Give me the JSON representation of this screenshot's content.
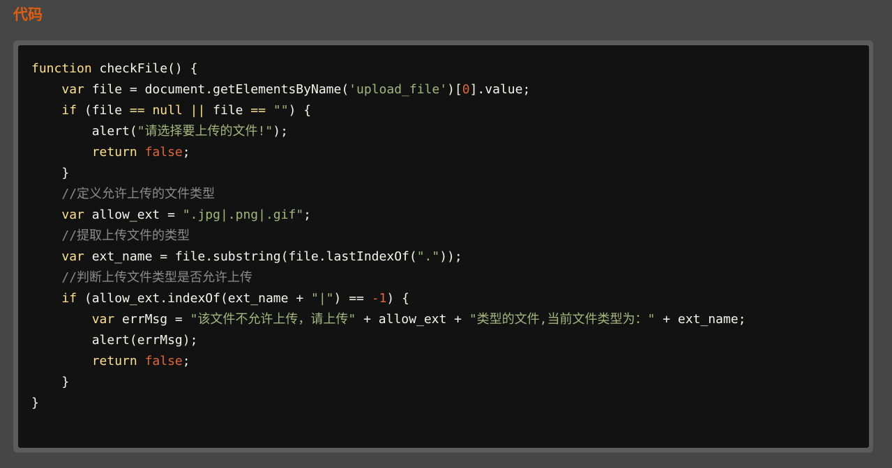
{
  "section": {
    "title": "代码"
  },
  "code": {
    "language": "javascript",
    "lines": [
      [
        {
          "t": "kw",
          "v": "function"
        },
        {
          "t": "pl",
          "v": " checkFile() {"
        }
      ],
      [
        {
          "t": "pl",
          "v": "    "
        },
        {
          "t": "kw",
          "v": "var"
        },
        {
          "t": "pl",
          "v": " file = document.getElementsByName("
        },
        {
          "t": "str",
          "v": "'upload_file'"
        },
        {
          "t": "pl",
          "v": ")["
        },
        {
          "t": "num",
          "v": "0"
        },
        {
          "t": "pl",
          "v": "].value;"
        }
      ],
      [
        {
          "t": "pl",
          "v": "    "
        },
        {
          "t": "kw",
          "v": "if"
        },
        {
          "t": "pl",
          "v": " (file "
        },
        {
          "t": "kw",
          "v": "=="
        },
        {
          "t": "pl",
          "v": " "
        },
        {
          "t": "kw",
          "v": "null"
        },
        {
          "t": "pl",
          "v": " "
        },
        {
          "t": "kw",
          "v": "||"
        },
        {
          "t": "pl",
          "v": " file "
        },
        {
          "t": "kw",
          "v": "=="
        },
        {
          "t": "pl",
          "v": " "
        },
        {
          "t": "str",
          "v": "\"\""
        },
        {
          "t": "pl",
          "v": ") {"
        }
      ],
      [
        {
          "t": "pl",
          "v": "        alert("
        },
        {
          "t": "str",
          "v": "\"请选择要上传的文件!\""
        },
        {
          "t": "pl",
          "v": ");"
        }
      ],
      [
        {
          "t": "pl",
          "v": "        "
        },
        {
          "t": "kw",
          "v": "return"
        },
        {
          "t": "pl",
          "v": " "
        },
        {
          "t": "bool",
          "v": "false"
        },
        {
          "t": "pl",
          "v": ";"
        }
      ],
      [
        {
          "t": "pl",
          "v": "    }"
        }
      ],
      [
        {
          "t": "pl",
          "v": "    "
        },
        {
          "t": "com",
          "v": "//定义允许上传的文件类型"
        }
      ],
      [
        {
          "t": "pl",
          "v": "    "
        },
        {
          "t": "kw",
          "v": "var"
        },
        {
          "t": "pl",
          "v": " allow_ext = "
        },
        {
          "t": "str",
          "v": "\".jpg|.png|.gif\""
        },
        {
          "t": "pl",
          "v": ";"
        }
      ],
      [
        {
          "t": "pl",
          "v": "    "
        },
        {
          "t": "com",
          "v": "//提取上传文件的类型"
        }
      ],
      [
        {
          "t": "pl",
          "v": "    "
        },
        {
          "t": "kw",
          "v": "var"
        },
        {
          "t": "pl",
          "v": " ext_name = file.substring(file.lastIndexOf("
        },
        {
          "t": "str",
          "v": "\".\""
        },
        {
          "t": "pl",
          "v": "));"
        }
      ],
      [
        {
          "t": "pl",
          "v": "    "
        },
        {
          "t": "com",
          "v": "//判断上传文件类型是否允许上传"
        }
      ],
      [
        {
          "t": "pl",
          "v": "    "
        },
        {
          "t": "kw",
          "v": "if"
        },
        {
          "t": "pl",
          "v": " (allow_ext.indexOf(ext_name + "
        },
        {
          "t": "str",
          "v": "\"|\""
        },
        {
          "t": "pl",
          "v": ") == "
        },
        {
          "t": "num",
          "v": "-1"
        },
        {
          "t": "pl",
          "v": ") {"
        }
      ],
      [
        {
          "t": "pl",
          "v": "        "
        },
        {
          "t": "kw",
          "v": "var"
        },
        {
          "t": "pl",
          "v": " errMsg = "
        },
        {
          "t": "str",
          "v": "\"该文件不允许上传，请上传\""
        },
        {
          "t": "pl",
          "v": " + allow_ext + "
        },
        {
          "t": "str",
          "v": "\"类型的文件,当前文件类型为：\""
        },
        {
          "t": "pl",
          "v": " + ext_name;"
        }
      ],
      [
        {
          "t": "pl",
          "v": "        alert(errMsg);"
        }
      ],
      [
        {
          "t": "pl",
          "v": "        "
        },
        {
          "t": "kw",
          "v": "return"
        },
        {
          "t": "pl",
          "v": " "
        },
        {
          "t": "bool",
          "v": "false"
        },
        {
          "t": "pl",
          "v": ";"
        }
      ],
      [
        {
          "t": "pl",
          "v": "    }"
        }
      ],
      [
        {
          "t": "pl",
          "v": "}"
        }
      ]
    ]
  },
  "colors": {
    "page_background": "#464646",
    "code_background": "#121212",
    "title_accent": "#e05d10",
    "keyword": "#fce08a",
    "string": "#a6b57c",
    "number": "#e0663a",
    "comment": "#8b8b8b",
    "plain": "#f5f5ee"
  }
}
